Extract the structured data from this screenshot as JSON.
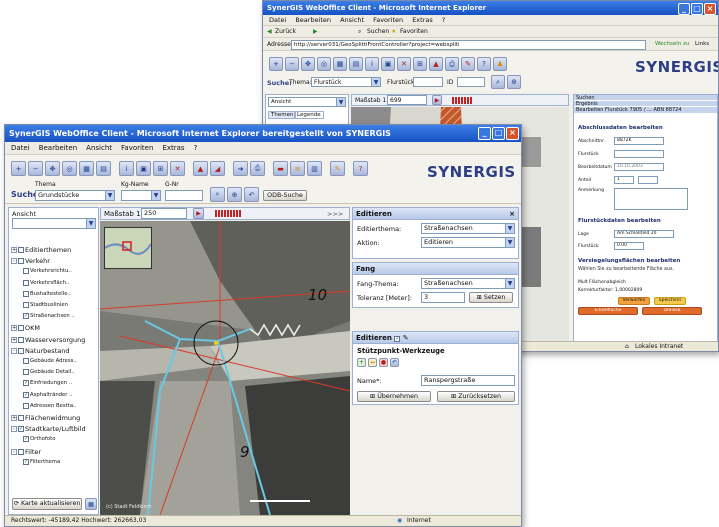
{
  "back_window": {
    "title": "SynerGIS WebOffice Client - Microsoft Internet Explorer",
    "menu": [
      "Datei",
      "Bearbeiten",
      "Ansicht",
      "Favoriten",
      "Extras",
      "?"
    ],
    "nav": {
      "back": "Zurück",
      "search": "Suchen",
      "favorites": "Favoriten"
    },
    "address_label": "Adresse",
    "address": "http://server031/GeoSplittiFrontController?project=webspliti",
    "go_label": "Wechseln zu",
    "links_label": "Links",
    "brand": "SYNERGIS",
    "search_label": "Suche:",
    "thema_label": "Thema:",
    "thema_value": "Flurstück",
    "flurstueck_label": "Flurstück",
    "id_label": "ID",
    "ansicht_label": "Ansicht",
    "themen_tab": "Themen",
    "legende_tab": "Legende",
    "massstab_label": "Maßstab 1:",
    "massstab_value": "699",
    "right_panel": {
      "rows": [
        "Suchen",
        "Ergebnis",
        "Bearbeiten Flurstück 7905 / ... ABN 88724"
      ],
      "section1": "Abschlussdaten bearbeiten",
      "fields": [
        {
          "label": "Abschnittnr.",
          "value": "8872K"
        },
        {
          "label": "Flurstück",
          "value": ""
        },
        {
          "label": "Bearbeitdatum",
          "value": "10.10.2003"
        },
        {
          "label": "Anteil",
          "value": "1"
        },
        {
          "label": "Anmerkung",
          "value": ""
        }
      ],
      "section2": "Flurstückdaten bearbeiten",
      "fields2": [
        {
          "label": "Lage",
          "value": "Am Schloßfeld 20"
        },
        {
          "label": "Flurstück",
          "value": "0.00"
        }
      ],
      "section3": "Versiegelungsflächen bearbeiten",
      "hint": "Wählen Sie zu bearbeitende Fläche aus.",
      "mulit_label": "Mult Flächenabgleich",
      "faktor_label": "Korrekturfaktor: 1,00002809",
      "btn_verwerfen": "Verwerfen",
      "btn_speichern": "Speichern",
      "btn_einzelfl": "Einzelfläche",
      "btn_dreieck": "Dreieck"
    },
    "status_zone": "Lokales Intranet"
  },
  "front_window": {
    "title": "SynerGIS WebOffice Client - Microsoft Internet Explorer bereitgestellt von SYNERGIS",
    "menu": [
      "Datei",
      "Bearbeiten",
      "Ansicht",
      "Favoriten",
      "Extras",
      "?"
    ],
    "brand": "SYNERGIS",
    "search_label": "Suche:",
    "thema_label": "Thema",
    "thema_value": "Grundstücke",
    "kg_label": "Kg-Name",
    "gst_label": "G-Nr",
    "odb_button": "ODB-Suche",
    "ansicht_label": "Ansicht",
    "massstab_label": "Maßstab 1:",
    "massstab_value": "250",
    "nav_arrows": ">>>",
    "tree": [
      {
        "label": "Editierthemen",
        "level": 0,
        "pm": "+",
        "checked": false
      },
      {
        "label": "Verkehr",
        "level": 0,
        "pm": "-",
        "checked": false
      },
      {
        "label": "Verkehrsrichtu..",
        "level": 2,
        "checked": false
      },
      {
        "label": "Verkehrsfläch..",
        "level": 2,
        "checked": false
      },
      {
        "label": "Bushaltestelle..",
        "level": 2,
        "checked": false
      },
      {
        "label": "Stadtbuslinien",
        "level": 2,
        "checked": false
      },
      {
        "label": "Straßenachsen ..",
        "level": 2,
        "checked": true
      },
      {
        "label": "OKM",
        "level": 0,
        "pm": "+",
        "checked": false
      },
      {
        "label": "Wasserversorgung",
        "level": 0,
        "pm": "+",
        "checked": false
      },
      {
        "label": "Naturbestand",
        "level": 0,
        "pm": "-",
        "checked": false
      },
      {
        "label": "Gebäude Adress..",
        "level": 2,
        "checked": false
      },
      {
        "label": "Gebäude Detail..",
        "level": 2,
        "checked": false
      },
      {
        "label": "Einfriedungen ..",
        "level": 2,
        "checked": true
      },
      {
        "label": "Asphaltränder ..",
        "level": 2,
        "checked": true
      },
      {
        "label": "Adressen Bestta..",
        "level": 2,
        "checked": false
      },
      {
        "label": "Flächenwidmung",
        "level": 0,
        "pm": "+",
        "checked": false
      },
      {
        "label": "Stadtkarte/Luftbild",
        "level": 0,
        "pm": "-",
        "checked": true
      },
      {
        "label": "Orthofoto",
        "level": 2,
        "checked": true
      },
      {
        "label": "Filter",
        "level": 0,
        "pm": "-",
        "checked": false
      },
      {
        "label": "Filterthema",
        "level": 2,
        "checked": true
      }
    ],
    "refresh_button": "Karte aktualisieren",
    "map_numbers": [
      "10",
      "9"
    ],
    "copyright": "(c) Stadt Feldkirch",
    "edit_panel": {
      "title": "Editieren",
      "editierthema_label": "Editierthema:",
      "editierthema_value": "Straßenachsen",
      "aktion_label": "Aktion:",
      "aktion_value": "Editieren"
    },
    "fang_panel": {
      "title": "Fang",
      "fangthema_label": "Fang-Thema:",
      "fangthema_value": "Straßenachsen",
      "toleranz_label": "Toleranz [Meter]:",
      "toleranz_value": "3",
      "setzen_button": "Setzen"
    },
    "edit2_panel": {
      "title": "Editieren",
      "werkzeuge_title": "Stützpunkt-Werkzeuge",
      "name_label": "Name*:",
      "name_value": "Ranspergstraße",
      "uebernehmen_button": "Übernehmen",
      "zuruecksetzen_button": "Zurücksetzen"
    },
    "status_coords": "Rechtswert: -45189,42 Hochwert: 262663,03",
    "status_zone": "Internet"
  },
  "colors": {
    "titlebar": "#1751c4",
    "brand": "#2e3e86",
    "accent": "#c82020"
  }
}
